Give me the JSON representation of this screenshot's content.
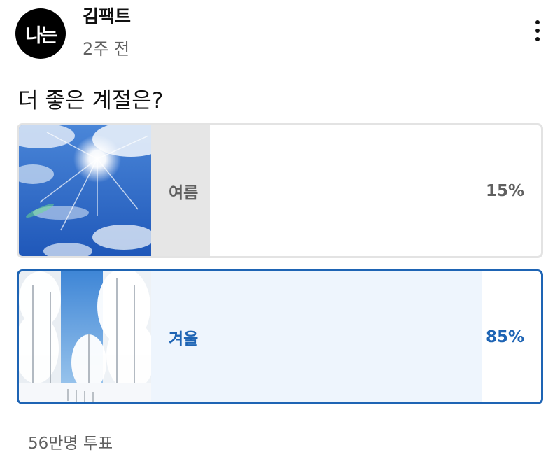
{
  "channel": {
    "avatar_text": "나는",
    "name": "김팩트",
    "posted": "2주 전"
  },
  "poll": {
    "question": "더 좋은 계절은?",
    "options": [
      {
        "label": "여름",
        "percent_text": "15%",
        "fraction": 0.15,
        "selected": false,
        "image": "sunny-blue-sky"
      },
      {
        "label": "겨울",
        "percent_text": "85%",
        "fraction": 0.85,
        "selected": true,
        "image": "snowy-forest"
      }
    ],
    "votes": "56만명 투표"
  },
  "colors": {
    "accent": "#1e64b4",
    "selected_fill": "#eef5fd",
    "unselected_fill": "#e6e6e6",
    "muted_text": "#606060"
  }
}
